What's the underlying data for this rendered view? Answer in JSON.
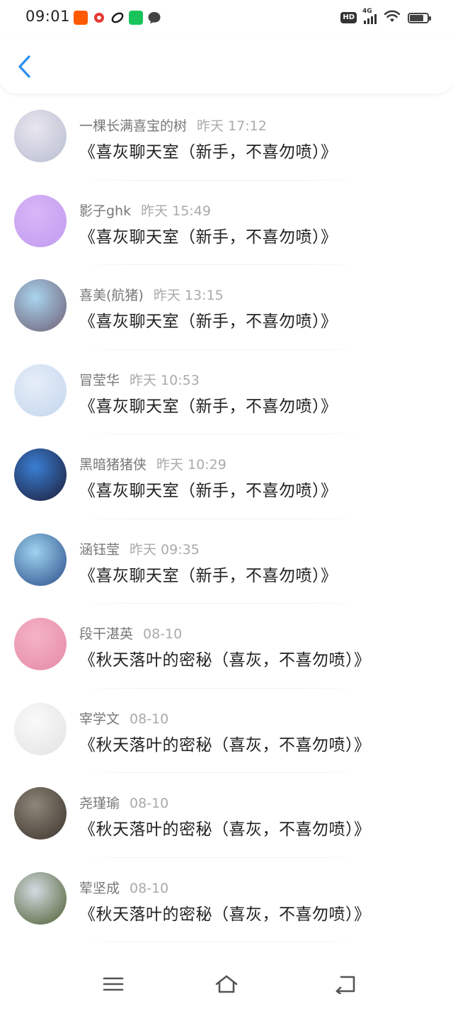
{
  "status_bar": {
    "time": "09:01",
    "hd": "HD",
    "network": "4G",
    "app_icons": [
      {
        "name": "taobao-icon",
        "color": "#ff5a00"
      },
      {
        "name": "red-app-icon",
        "color": "#e53935"
      },
      {
        "name": "link-app-icon",
        "color": "#1a1a1a"
      },
      {
        "name": "iqiyi-icon",
        "color": "#18c45a"
      },
      {
        "name": "chat-bubble-icon",
        "color": "#444444"
      }
    ]
  },
  "header": {
    "back_icon": "chevron-left-icon",
    "accent_color": "#2b8ff0"
  },
  "messages": [
    {
      "name": "一棵长满喜宝的树",
      "time": "昨天 17:12",
      "title": "《喜灰聊天室（新手，不喜勿喷）》",
      "avatar_colors": [
        "#e9e6ef",
        "#b7bdd0"
      ]
    },
    {
      "name": "影子ghk",
      "time": "昨天 15:49",
      "title": "《喜灰聊天室（新手，不喜勿喷）》",
      "avatar_colors": [
        "#d9b6f7",
        "#c09bf0"
      ]
    },
    {
      "name": "喜美(航猪)",
      "time": "昨天 13:15",
      "title": "《喜灰聊天室（新手，不喜勿喷）》",
      "avatar_colors": [
        "#a9d4ee",
        "#6e5e73"
      ]
    },
    {
      "name": "冒莹华",
      "time": "昨天 10:53",
      "title": "《喜灰聊天室（新手，不喜勿喷）》",
      "avatar_colors": [
        "#e6eef8",
        "#c4d6ee"
      ]
    },
    {
      "name": "黑暗猪猪侠",
      "time": "昨天 10:29",
      "title": "《喜灰聊天室（新手，不喜勿喷）》",
      "avatar_colors": [
        "#3a7fd4",
        "#1c1c36"
      ]
    },
    {
      "name": "涵钰莹",
      "time": "昨天 09:35",
      "title": "《喜灰聊天室（新手，不喜勿喷）》",
      "avatar_colors": [
        "#9fd3ee",
        "#2a4d8a"
      ]
    },
    {
      "name": "段干湛英",
      "time": "08-10",
      "title": "《秋天落叶的密秘（喜灰，不喜勿喷）》",
      "avatar_colors": [
        "#f5b3c5",
        "#e58aa6"
      ]
    },
    {
      "name": "宰学文",
      "time": "08-10",
      "title": "《秋天落叶的密秘（喜灰，不喜勿喷）》",
      "avatar_colors": [
        "#fafafa",
        "#e2e2e2"
      ]
    },
    {
      "name": "尧瑾瑜",
      "time": "08-10",
      "title": "《秋天落叶的密秘（喜灰，不喜勿喷）》",
      "avatar_colors": [
        "#8e8679",
        "#3b342c"
      ]
    },
    {
      "name": "荤坚成",
      "time": "08-10",
      "title": "《秋天落叶的密秘（喜灰，不喜勿喷）》",
      "avatar_colors": [
        "#d5dbe2",
        "#4a5d2f"
      ]
    }
  ],
  "bottom_nav": {
    "menu_icon": "menu-icon",
    "home_icon": "home-icon",
    "back_icon": "back-return-icon"
  }
}
